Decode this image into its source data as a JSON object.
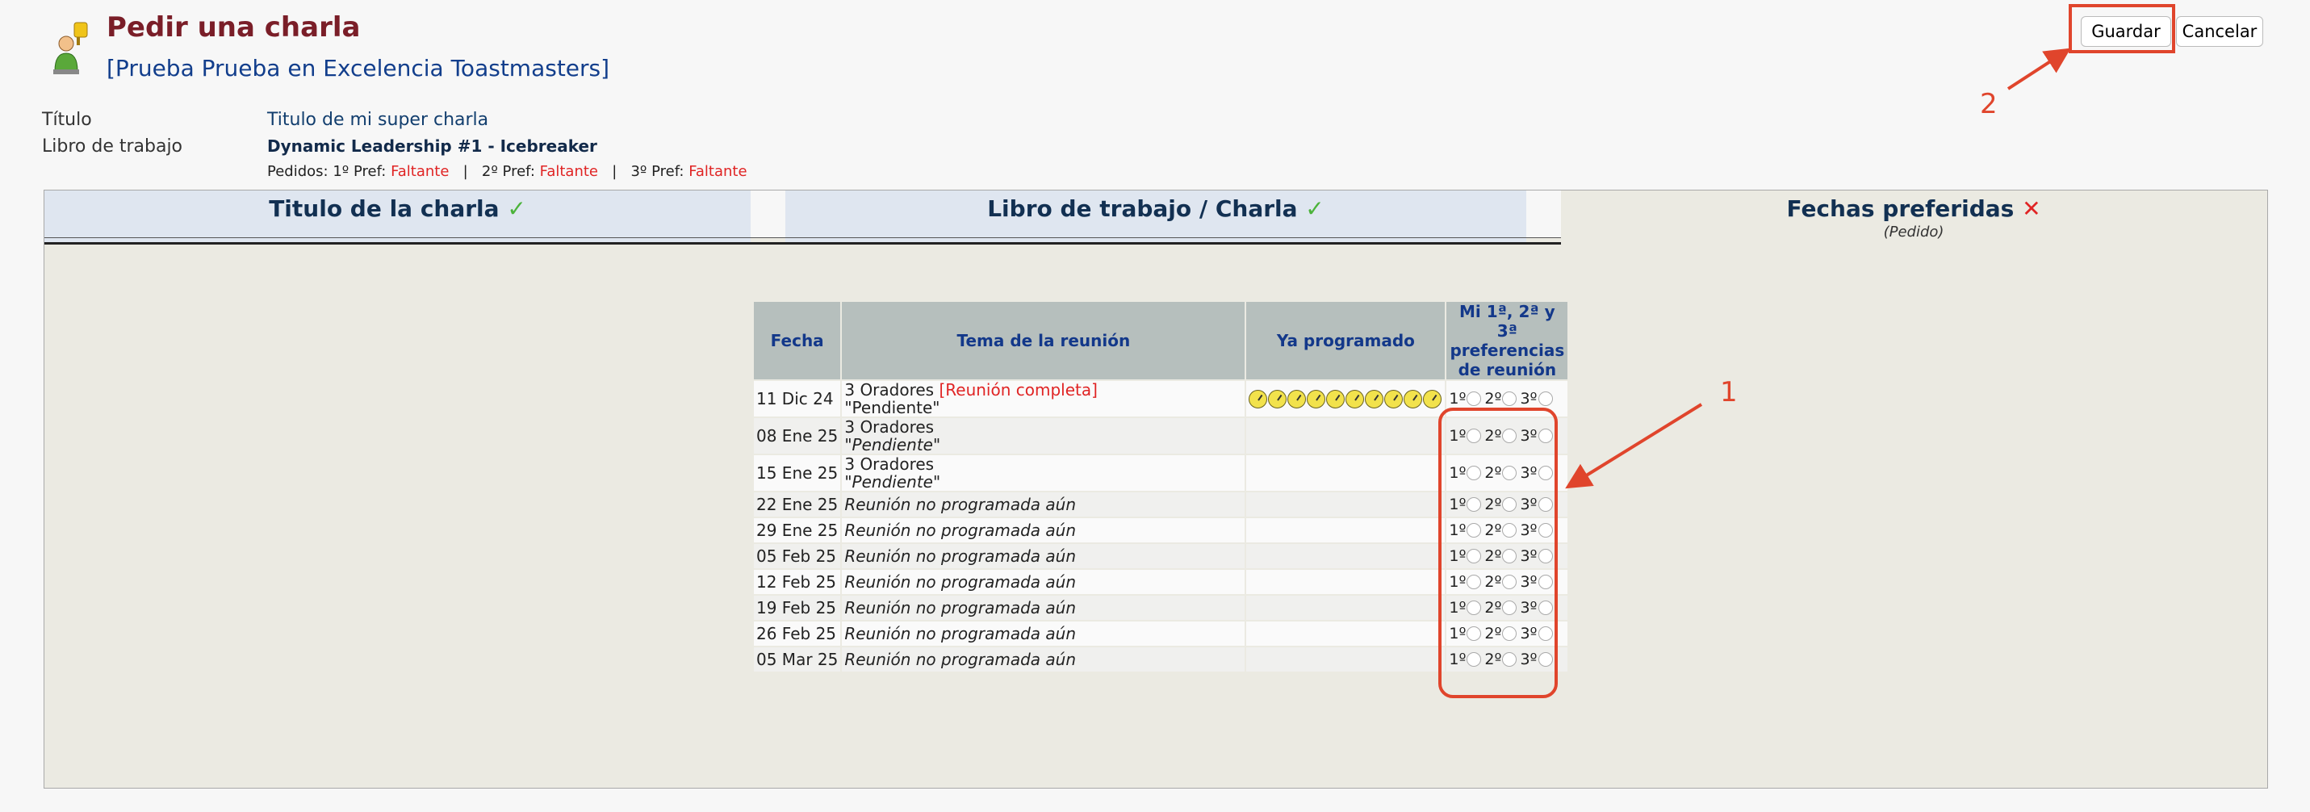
{
  "header": {
    "title": "Pedir una charla",
    "club": "[Prueba Prueba en Excelencia Toastmasters]"
  },
  "buttons": {
    "save": "Guardar",
    "cancel": "Cancelar"
  },
  "info": {
    "titulo_label": "Título",
    "titulo_value": "Titulo de mi super charla",
    "libro_label": "Libro de trabajo",
    "libro_value": "Dynamic Leadership #1 - Icebreaker",
    "pedidos_prefix": "Pedidos: 1º Pref: ",
    "pref2_prefix": "2º Pref: ",
    "pref3_prefix": "3º Pref: ",
    "separator": "|",
    "missing": "Faltante"
  },
  "tabs": [
    {
      "label": "Titulo de la charla",
      "status": "✓"
    },
    {
      "label": "Libro de trabajo / Charla",
      "status": "✓"
    },
    {
      "label": "Fechas preferidas",
      "status": "✕",
      "sub": "(Pedido)"
    }
  ],
  "table": {
    "headers": {
      "fecha": "Fecha",
      "tema": "Tema de la reunión",
      "ya": "Ya programado",
      "pref": "Mi 1ª, 2ª y 3ª preferencias de reunión"
    },
    "pref_labels": [
      "1º",
      "2º",
      "3º"
    ],
    "rows": [
      {
        "date": "11 Dic 24",
        "topic": "3 Oradores",
        "extra": "[Reunión completa]",
        "note": "\"Pendiente\"",
        "clocks": 10
      },
      {
        "date": "08 Ene 25",
        "topic": "3 Oradores",
        "extra": "",
        "note": "\"Pendiente\"",
        "clocks": 0
      },
      {
        "date": "15 Ene 25",
        "topic": "3 Oradores",
        "extra": "",
        "note": "\"Pendiente\"",
        "clocks": 0
      },
      {
        "date": "22 Ene 25",
        "topic": "Reunión no programada aún",
        "extra": "",
        "note": "",
        "clocks": 0
      },
      {
        "date": "29 Ene 25",
        "topic": "Reunión no programada aún",
        "extra": "",
        "note": "",
        "clocks": 0
      },
      {
        "date": "05 Feb 25",
        "topic": "Reunión no programada aún",
        "extra": "",
        "note": "",
        "clocks": 0
      },
      {
        "date": "12 Feb 25",
        "topic": "Reunión no programada aún",
        "extra": "",
        "note": "",
        "clocks": 0
      },
      {
        "date": "19 Feb 25",
        "topic": "Reunión no programada aún",
        "extra": "",
        "note": "",
        "clocks": 0
      },
      {
        "date": "26 Feb 25",
        "topic": "Reunión no programada aún",
        "extra": "",
        "note": "",
        "clocks": 0
      },
      {
        "date": "05 Mar 25",
        "topic": "Reunión no programada aún",
        "extra": "",
        "note": "",
        "clocks": 0
      }
    ]
  },
  "annotations": {
    "one": "1",
    "two": "2"
  },
  "colors": {
    "title": "#7a1e28",
    "link": "#123e8c",
    "missing": "#e02424",
    "annotation": "#e0452c",
    "check": "#4bb33a"
  }
}
